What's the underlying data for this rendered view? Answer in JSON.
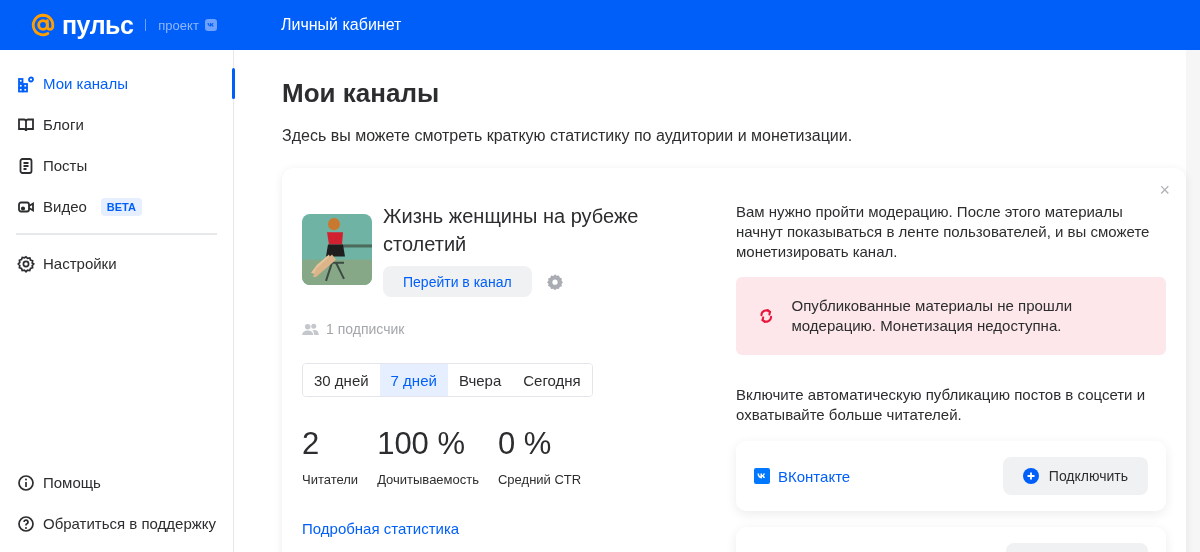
{
  "header": {
    "logo_text": "пульс",
    "logo_sub": "проект",
    "title": "Личный кабинет"
  },
  "sidebar": {
    "main_items": [
      {
        "label": "Мои каналы",
        "kind": "channels",
        "selected": true
      },
      {
        "label": "Блоги",
        "kind": "book",
        "selected": false
      },
      {
        "label": "Посты",
        "kind": "doc",
        "selected": false
      },
      {
        "label": "Видео",
        "kind": "video",
        "selected": false,
        "badge": "BETA"
      }
    ],
    "settings_items": [
      {
        "label": "Настройки",
        "kind": "gear",
        "selected": false
      }
    ],
    "bottom_items": [
      {
        "label": "Помощь",
        "kind": "info"
      },
      {
        "label": "Обратиться в поддержку",
        "kind": "support"
      }
    ]
  },
  "page": {
    "title": "Мои каналы",
    "description": "Здесь вы можете смотреть краткую статистику по аудитории и монетизации."
  },
  "channel": {
    "title": "Жизнь женщины на рубеже столетий",
    "go_button": "Перейти в канал",
    "subscribers": "1 подписчик",
    "periods": [
      {
        "label": "30 дней",
        "selected": false
      },
      {
        "label": "7 дней",
        "selected": true
      },
      {
        "label": "Вчера",
        "selected": false
      },
      {
        "label": "Сегодня",
        "selected": false
      }
    ],
    "stats": [
      {
        "value": "2",
        "label": "Читатели"
      },
      {
        "value": "100 %",
        "label": "Дочитываемость"
      },
      {
        "value": "0 %",
        "label": "Средний CTR"
      }
    ],
    "stats_link": "Подробная статистика"
  },
  "moderation": {
    "close": "×",
    "text": "Вам нужно пройти модерацию. После этого материалы начнут показываться в ленте пользователей, и вы сможете монетизировать канал.",
    "alert": "Опубликованные материалы не прошли модерацию. Монетизация недоступна.",
    "autopost_text": "Включите автоматическую публикацию постов в соцсети и охватывайте больше читателей.",
    "socials": [
      {
        "kind": "vk",
        "name": "ВКонтакте",
        "button": "Подключить"
      },
      {
        "kind": "hidden"
      }
    ]
  }
}
